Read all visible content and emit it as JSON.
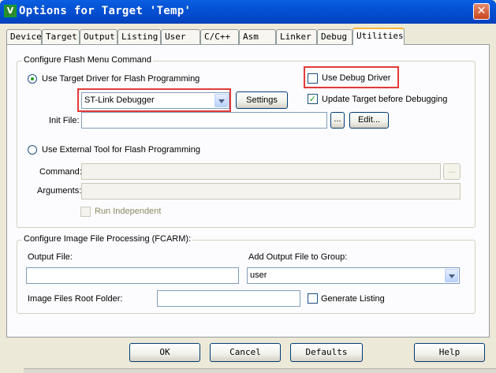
{
  "window": {
    "title": "Options for Target 'Temp'",
    "icon": "keil-v-icon",
    "close_glyph": "✕"
  },
  "tabs": [
    "Device",
    "Target",
    "Output",
    "Listing",
    "User",
    "C/C++",
    "Asm",
    "Linker",
    "Debug",
    "Utilities"
  ],
  "active_tab": "Utilities",
  "flash": {
    "group_label": "Configure Flash Menu Command",
    "use_target_driver": {
      "label": "Use Target Driver for Flash Programming",
      "selected": true
    },
    "driver_select": {
      "value": "ST-Link Debugger"
    },
    "settings_button": "Settings",
    "use_debug_driver": {
      "label": "Use Debug Driver",
      "checked": false
    },
    "update_target": {
      "label": "Update Target before Debugging",
      "checked": true
    },
    "init_file": {
      "label": "Init File:",
      "value": "",
      "browse": "...",
      "edit": "Edit..."
    },
    "use_external_tool": {
      "label": "Use External Tool for Flash Programming",
      "selected": false
    },
    "command": {
      "label": "Command:",
      "value": "",
      "browse": "..."
    },
    "arguments": {
      "label": "Arguments:",
      "value": ""
    },
    "run_independent": {
      "label": "Run Independent",
      "checked": false
    }
  },
  "image": {
    "group_label": "Configure Image File Processing (FCARM):",
    "output_file": {
      "label": "Output File:",
      "value": ""
    },
    "add_output": {
      "label": "Add Output File  to Group:",
      "value": "user"
    },
    "root_folder": {
      "label": "Image Files Root Folder:",
      "value": ""
    },
    "generate_listing": {
      "label": "Generate Listing",
      "checked": false
    }
  },
  "buttons": {
    "ok": "OK",
    "cancel": "Cancel",
    "defaults": "Defaults",
    "help": "Help"
  },
  "colors": {
    "highlight_box": "#e23a3a",
    "titlebar": "#0554d7"
  }
}
